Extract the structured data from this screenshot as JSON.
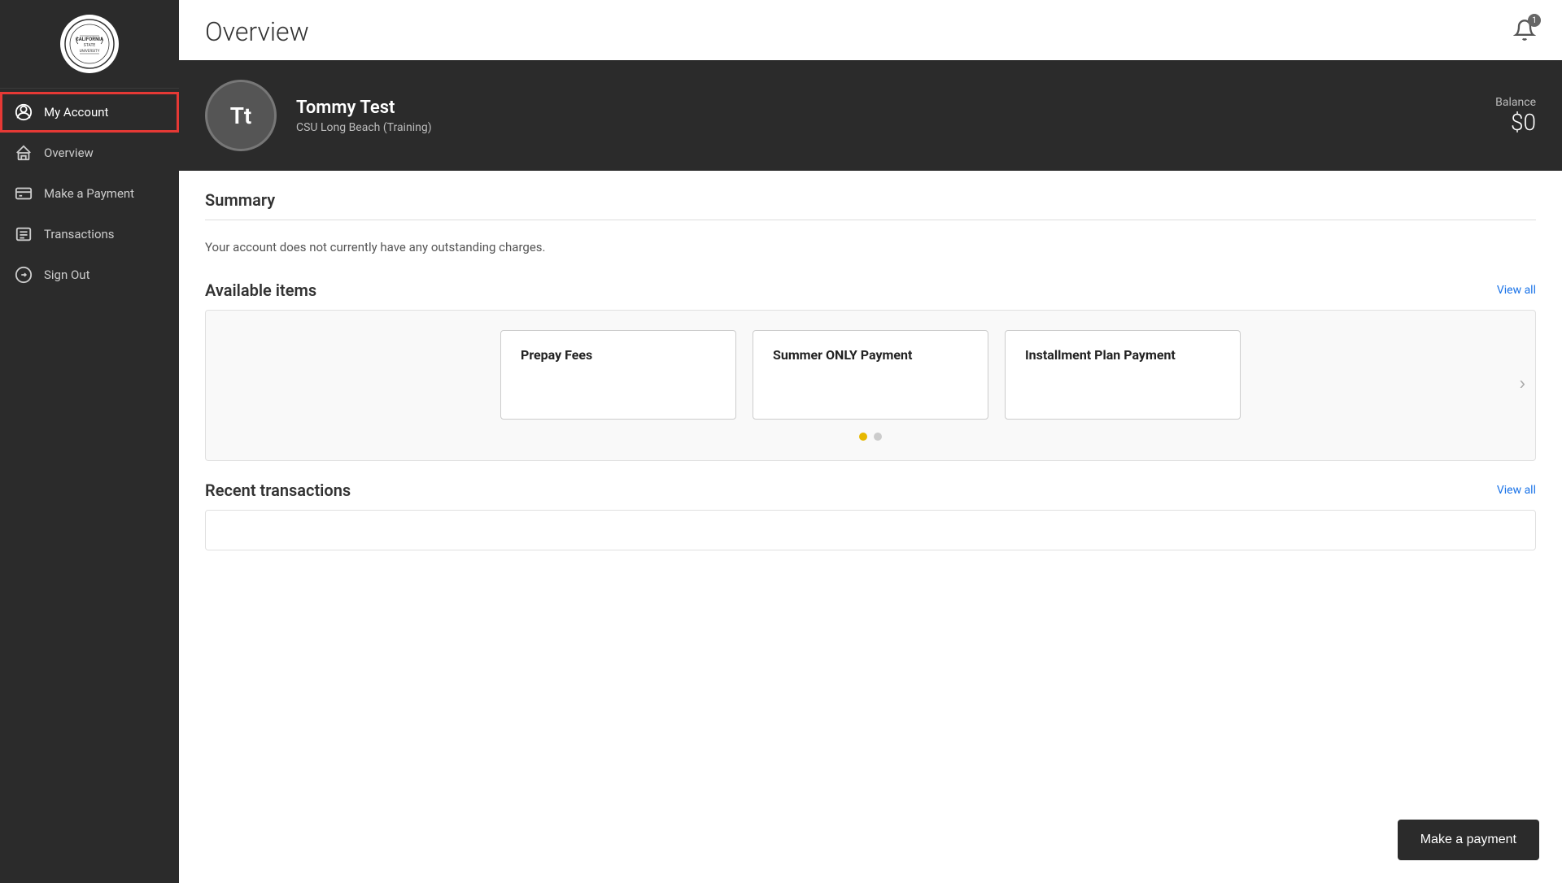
{
  "sidebar": {
    "logo_alt": "CSU Logo",
    "items": [
      {
        "id": "my-account",
        "label": "My Account",
        "icon": "user-circle-icon",
        "active": true
      },
      {
        "id": "overview",
        "label": "Overview",
        "icon": "home-icon",
        "active": false
      },
      {
        "id": "make-payment",
        "label": "Make a Payment",
        "icon": "payment-icon",
        "active": false
      },
      {
        "id": "transactions",
        "label": "Transactions",
        "icon": "transactions-icon",
        "active": false
      },
      {
        "id": "sign-out",
        "label": "Sign Out",
        "icon": "signout-icon",
        "active": false
      }
    ]
  },
  "topbar": {
    "title": "Overview",
    "bell_badge": "1"
  },
  "profile": {
    "initials": "Tt",
    "name": "Tommy Test",
    "school": "CSU Long Beach (Training)",
    "balance_label": "Balance",
    "balance_amount": "$0"
  },
  "summary": {
    "title": "Summary",
    "message": "Your account does not currently have any outstanding charges."
  },
  "available_items": {
    "title": "Available items",
    "view_all_label": "View all",
    "cards": [
      {
        "id": "prepay-fees",
        "title": "Prepay Fees"
      },
      {
        "id": "summer-only",
        "title": "Summer ONLY Payment"
      },
      {
        "id": "installment",
        "title": "Installment Plan Payment"
      }
    ],
    "dots": [
      {
        "active": true
      },
      {
        "active": false
      }
    ],
    "nav_arrow": "›"
  },
  "recent_transactions": {
    "title": "Recent transactions",
    "view_all_label": "View all"
  },
  "footer": {
    "make_payment_label": "Make a payment"
  }
}
